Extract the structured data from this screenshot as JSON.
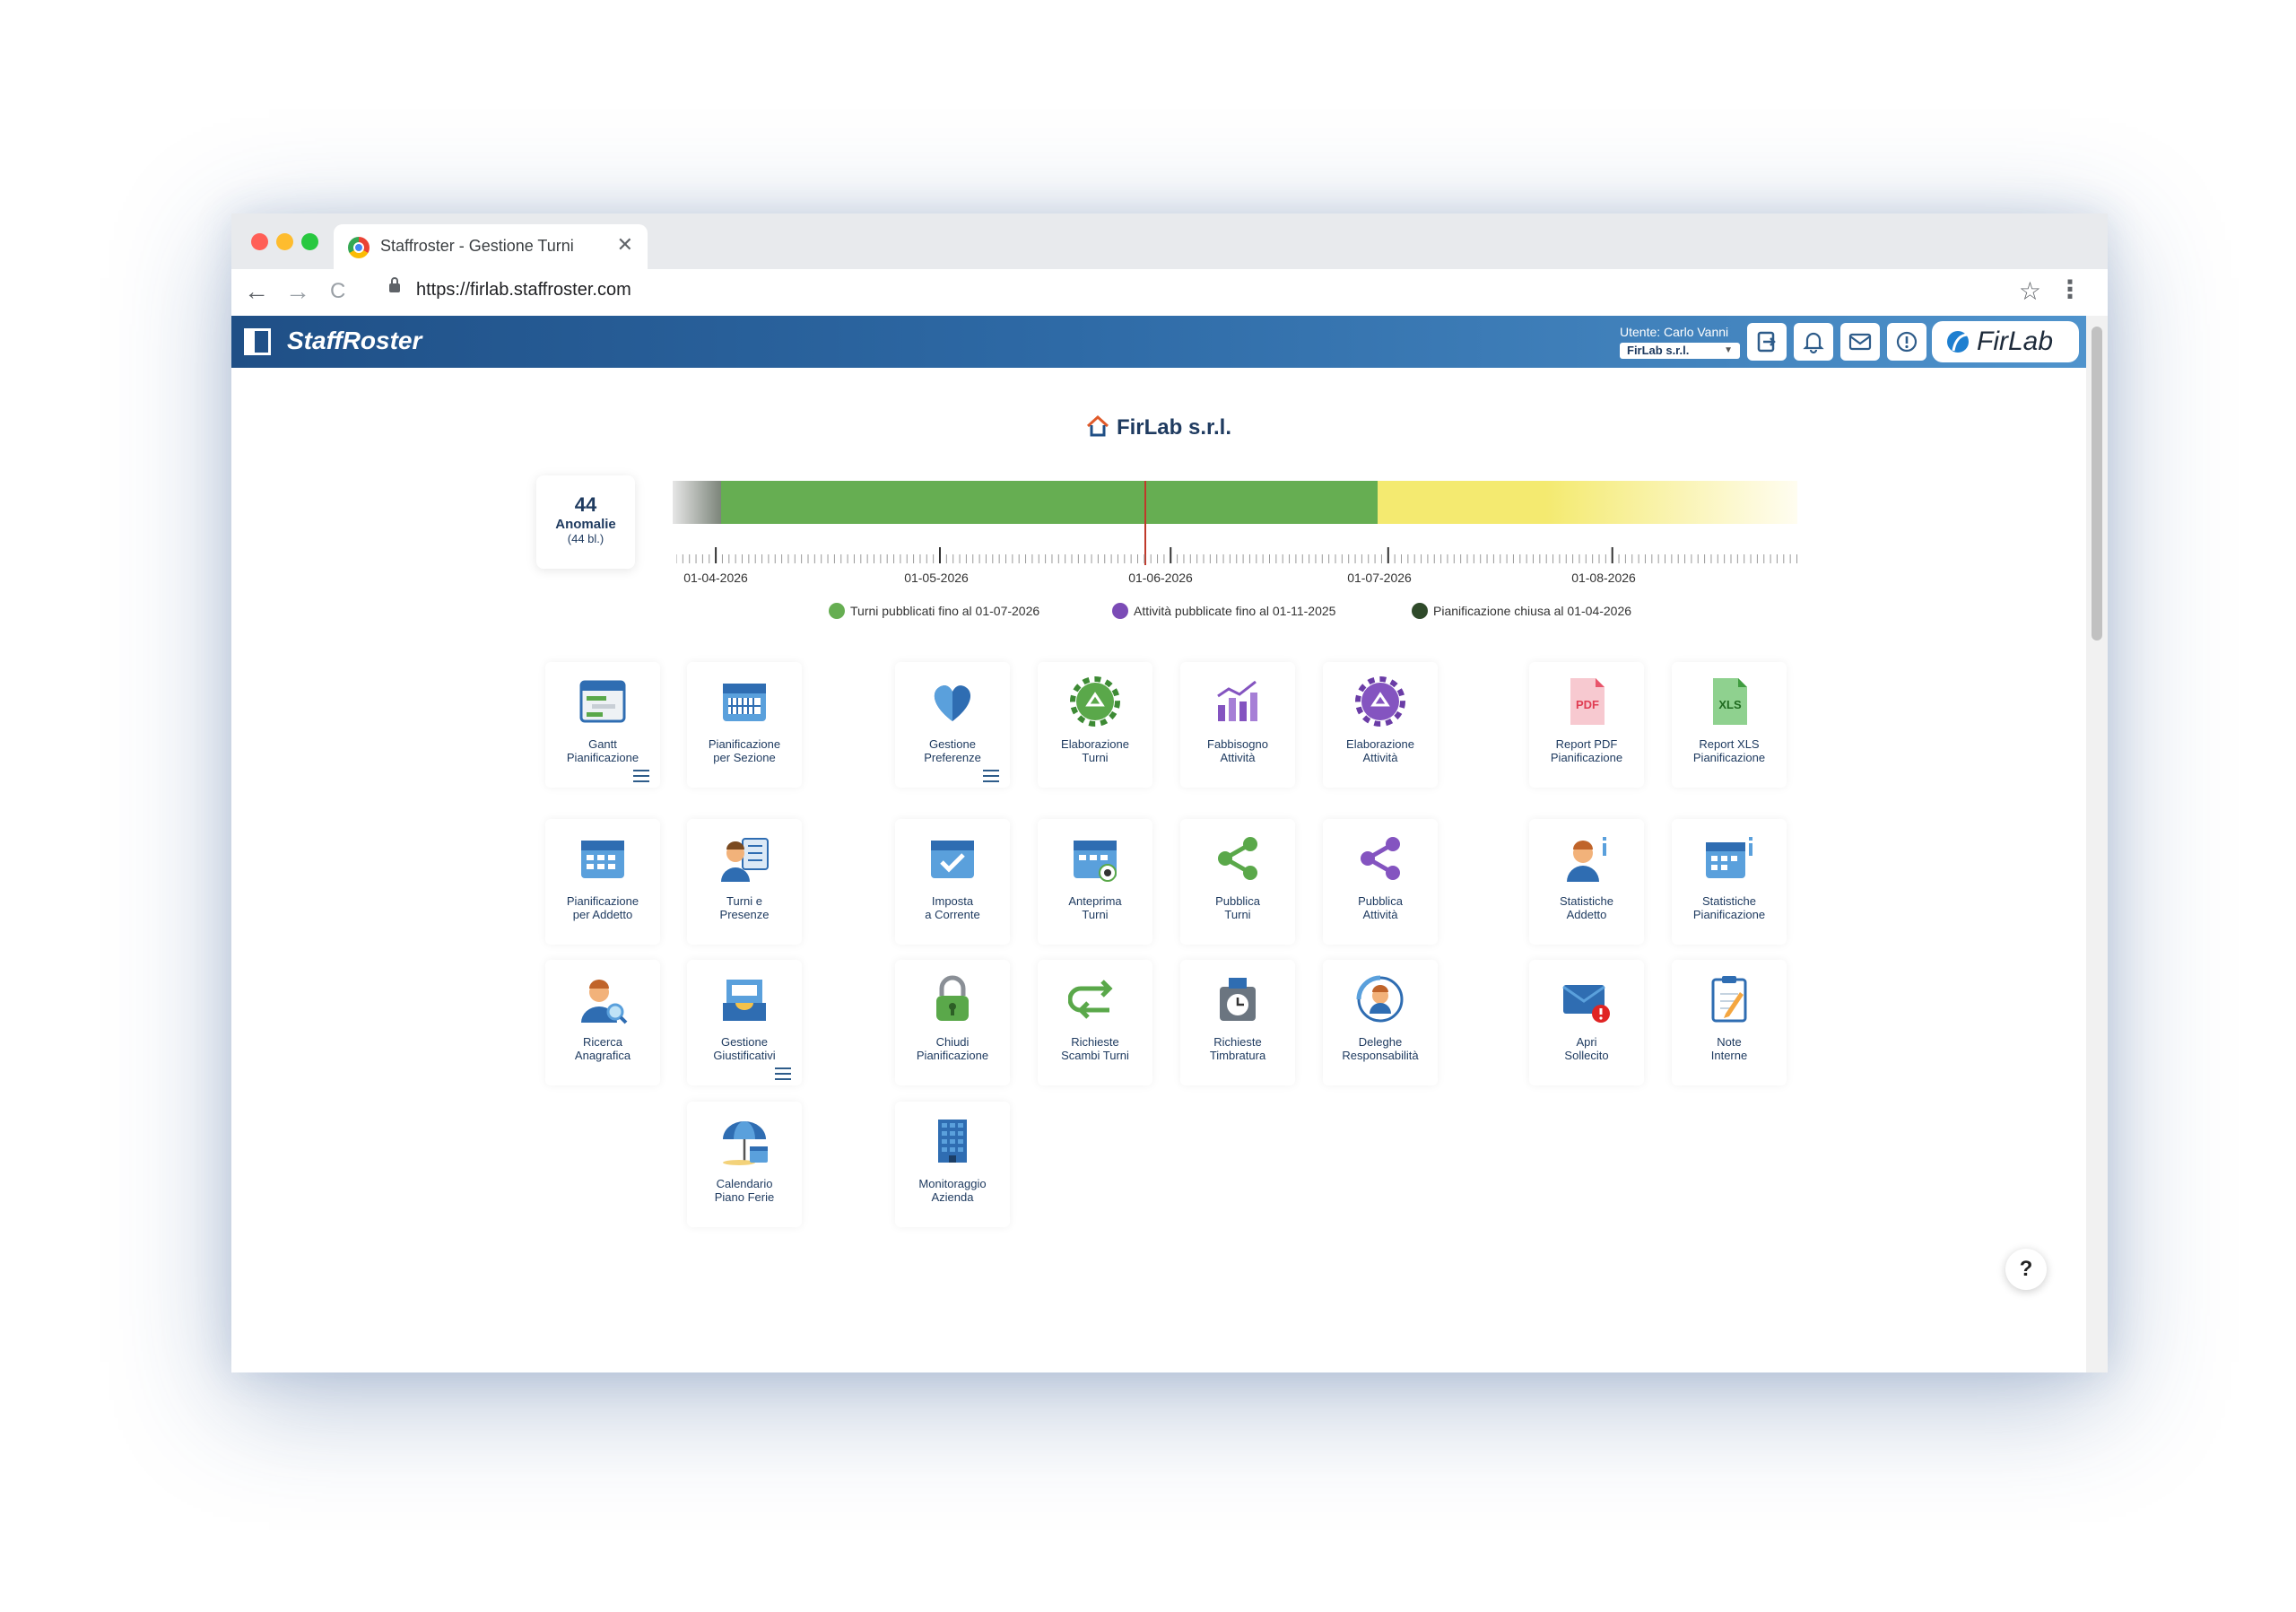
{
  "browser": {
    "tab_title": "Staffroster - Gestione Turni",
    "tab_close": "✕",
    "url": "https://firlab.staffroster.com",
    "back": "←",
    "forward": "→",
    "reload": "C",
    "star": "☆",
    "menu": "⋮"
  },
  "header": {
    "app_name": "StaffRoster",
    "user_label": "Utente: Carlo Vanni",
    "company_selected": "FirLab s.r.l.",
    "brand": "FirLab",
    "buttons": [
      "export-icon",
      "bell-icon",
      "mail-icon",
      "alert-icon"
    ]
  },
  "page": {
    "company_title": "FirLab s.r.l."
  },
  "anomalies": {
    "count": "44",
    "label": "Anomalie",
    "sub": "(44 bl.)"
  },
  "timeline": {
    "ticks": [
      "01-04-2026",
      "01-05-2026",
      "01-06-2026",
      "01-07-2026",
      "01-08-2026"
    ],
    "legend": [
      {
        "label": "Turni pubblicati fino al 01-07-2026",
        "color": "#66ae52"
      },
      {
        "label": "Attività pubblicate fino al 01-11-2025",
        "color": "#7b4bb6"
      },
      {
        "label": "Pianificazione chiusa al 01-04-2026",
        "color": "#2f4a2a"
      }
    ]
  },
  "tiles": [
    {
      "l1": "Gantt",
      "l2": "Pianificazione",
      "icon": "gantt-icon"
    },
    {
      "l1": "Pianificazione",
      "l2": "per Sezione",
      "icon": "calendar-grid-icon"
    },
    {
      "l1": "Gestione",
      "l2": "Preferenze",
      "icon": "heart-icon"
    },
    {
      "l1": "Elaborazione",
      "l2": "Turni",
      "icon": "gear-recycle-icon"
    },
    {
      "l1": "Fabbisogno",
      "l2": "Attività",
      "icon": "bar-chart-icon"
    },
    {
      "l1": "Elaborazione",
      "l2": "Attività",
      "icon": "gear-purple-icon"
    },
    {
      "l1": "Report PDF",
      "l2": "Pianificazione",
      "icon": "pdf-icon",
      "badge": "PDF"
    },
    {
      "l1": "Report XLS",
      "l2": "Pianificazione",
      "icon": "xls-icon",
      "badge": "XLS"
    },
    {
      "l1": "Pianificazione",
      "l2": "per Addetto",
      "icon": "calendar-person-icon"
    },
    {
      "l1": "Turni e",
      "l2": "Presenze",
      "icon": "person-checklist-icon"
    },
    {
      "l1": "Imposta",
      "l2": "a Corrente",
      "icon": "calendar-check-icon"
    },
    {
      "l1": "Anteprima",
      "l2": "Turni",
      "icon": "calendar-eye-icon"
    },
    {
      "l1": "Pubblica",
      "l2": "Turni",
      "icon": "share-green-icon"
    },
    {
      "l1": "Pubblica",
      "l2": "Attività",
      "icon": "share-purple-icon"
    },
    {
      "l1": "Statistiche",
      "l2": "Addetto",
      "icon": "person-info-icon"
    },
    {
      "l1": "Statistiche",
      "l2": "Pianificazione",
      "icon": "calendar-info-icon"
    },
    {
      "l1": "Ricerca",
      "l2": "Anagrafica",
      "icon": "person-search-icon"
    },
    {
      "l1": "Gestione",
      "l2": "Giustificativi",
      "icon": "inbox-icon"
    },
    {
      "l1": "Chiudi",
      "l2": "Pianificazione",
      "icon": "padlock-icon"
    },
    {
      "l1": "Richieste",
      "l2": "Scambi Turni",
      "icon": "swap-icon"
    },
    {
      "l1": "Richieste",
      "l2": "Timbratura",
      "icon": "time-clock-icon"
    },
    {
      "l1": "Deleghe",
      "l2": "Responsabilità",
      "icon": "person-circle-icon"
    },
    {
      "l1": "Apri",
      "l2": "Sollecito",
      "icon": "mail-alert-icon"
    },
    {
      "l1": "Note",
      "l2": "Interne",
      "icon": "notepad-icon"
    },
    {
      "l1": "Calendario",
      "l2": "Piano Ferie",
      "icon": "umbrella-calendar-icon"
    },
    {
      "l1": "Monitoraggio",
      "l2": "Azienda",
      "icon": "building-icon"
    }
  ],
  "help": "?"
}
